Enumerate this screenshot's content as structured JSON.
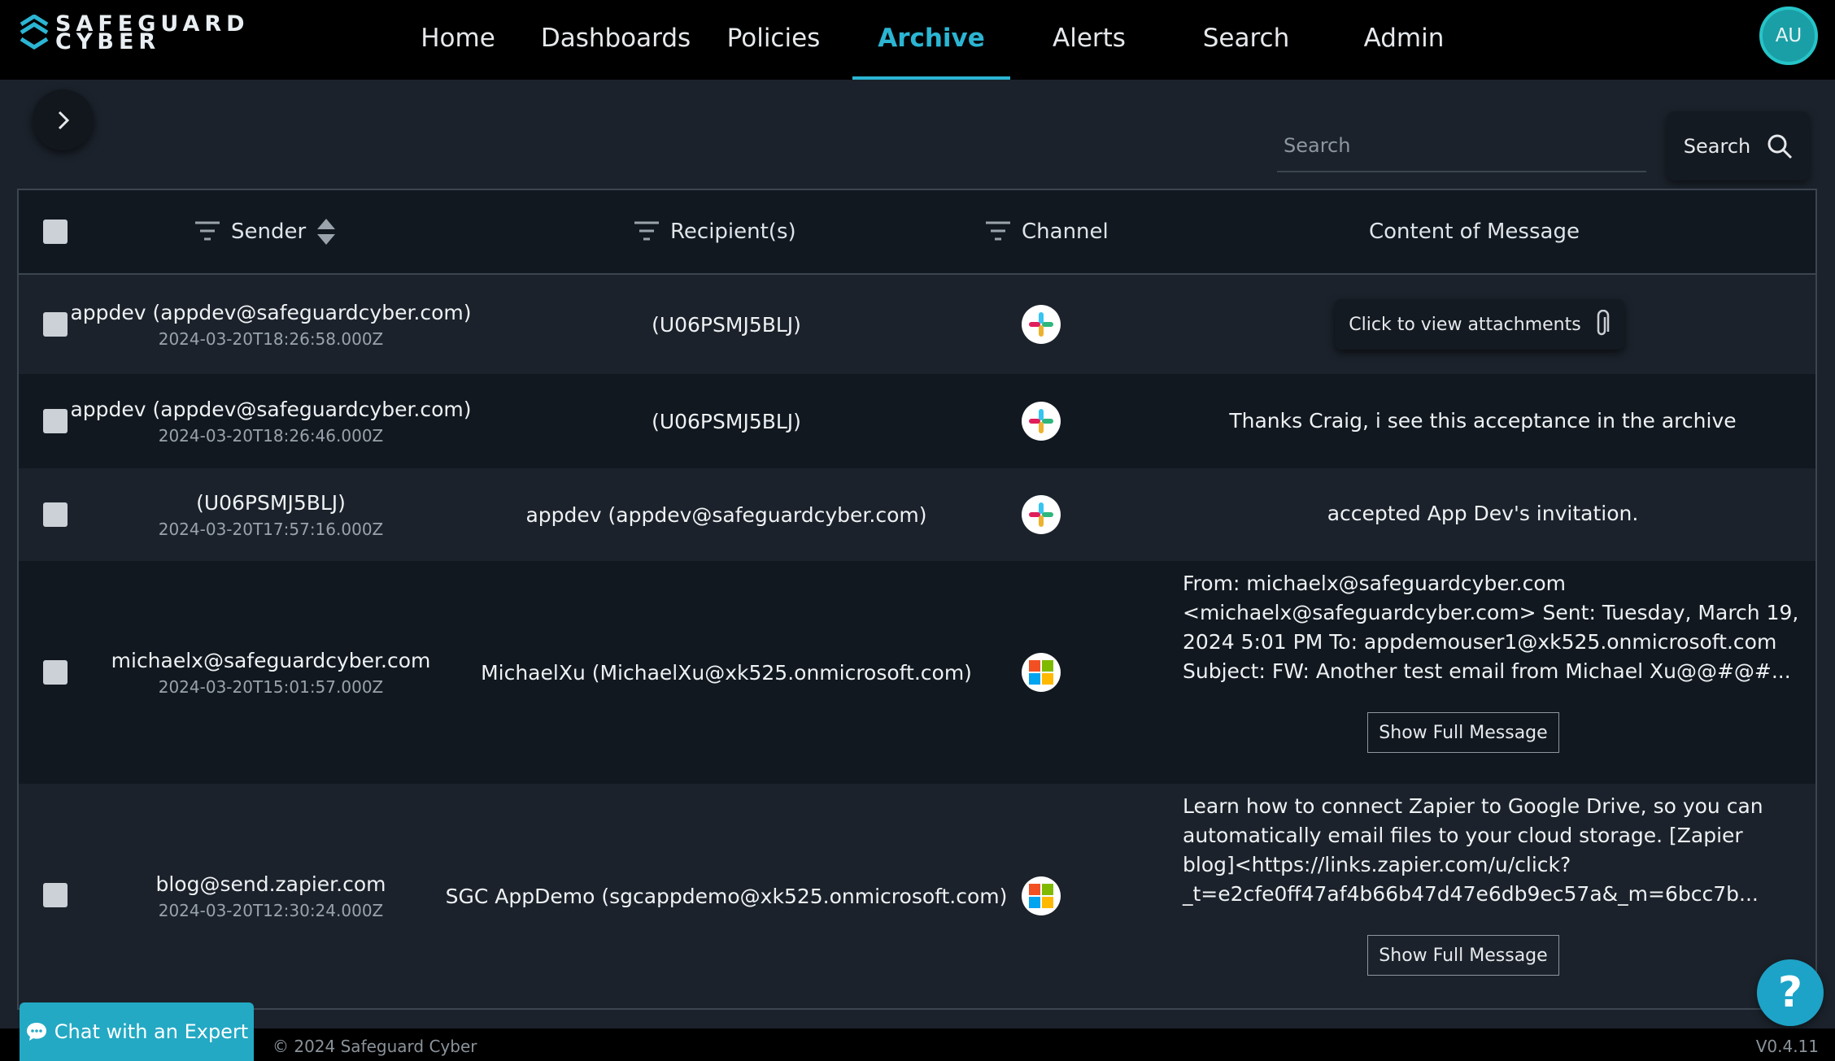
{
  "app": {
    "logo_line1": "SAFEGUARD",
    "logo_line2": "CYBER",
    "avatar_initials": "AU",
    "accent": "#2bb5d3"
  },
  "nav": {
    "items": [
      {
        "label": "Home",
        "active": false
      },
      {
        "label": "Dashboards",
        "active": false
      },
      {
        "label": "Policies",
        "active": false
      },
      {
        "label": "Archive",
        "active": true
      },
      {
        "label": "Alerts",
        "active": false
      },
      {
        "label": "Search",
        "active": false
      },
      {
        "label": "Admin",
        "active": false
      }
    ]
  },
  "search": {
    "placeholder": "Search",
    "button_label": "Search"
  },
  "table": {
    "headers": {
      "sender": "Sender",
      "recipients": "Recipient(s)",
      "channel": "Channel",
      "content": "Content of Message"
    },
    "rows": [
      {
        "sender": "appdev (appdev@safeguardcyber.com)",
        "time": "2024-03-20T18:26:58.000Z",
        "recipient": "(U06PSMJ5BLJ)",
        "channel": "slack-icon",
        "content": "",
        "attachment_label": "Click to view attachments"
      },
      {
        "sender": "appdev (appdev@safeguardcyber.com)",
        "time": "2024-03-20T18:26:46.000Z",
        "recipient": "(U06PSMJ5BLJ)",
        "channel": "slack-icon",
        "content": "Thanks Craig, i see this acceptance in the archive"
      },
      {
        "sender": "(U06PSMJ5BLJ)",
        "time": "2024-03-20T17:57:16.000Z",
        "recipient": "appdev (appdev@safeguardcyber.com)",
        "channel": "slack-icon",
        "content": "accepted App Dev's invitation."
      },
      {
        "sender": "michaelx@safeguardcyber.com",
        "time": "2024-03-20T15:01:57.000Z",
        "recipient": "MichaelXu (MichaelXu@xk525.onmicrosoft.com)",
        "channel": "microsoft-icon",
        "content_lines": [
          "From: michaelx@safeguardcyber.com",
          "<michaelx@safeguardcyber.com> Sent: Tuesday, March 19,",
          "2024 5:01 PM To: appdemouser1@xk525.onmicrosoft.com",
          "Subject: FW: Another test email from Michael Xu@@#@#..."
        ],
        "show_label": "Show Full Message"
      },
      {
        "sender": "blog@send.zapier.com",
        "time": "2024-03-20T12:30:24.000Z",
        "recipient": "SGC AppDemo (sgcappdemo@xk525.onmicrosoft.com)",
        "channel": "microsoft-icon",
        "content_lines": [
          "Learn how to connect Zapier to Google Drive, so you can",
          "automatically email files to your cloud storage. [Zapier",
          "blog]<https://links.zapier.com/u/click?",
          "_t=e2cfe0ff47af4b66b47d47e6db9ec57a&_m=6bcc7b..."
        ],
        "show_label": "Show Full Message"
      }
    ]
  },
  "footer": {
    "chat_label": "Chat with an Expert",
    "copyright": "© 2024 Safeguard Cyber",
    "version": "V0.4.11",
    "help_label": "?"
  }
}
